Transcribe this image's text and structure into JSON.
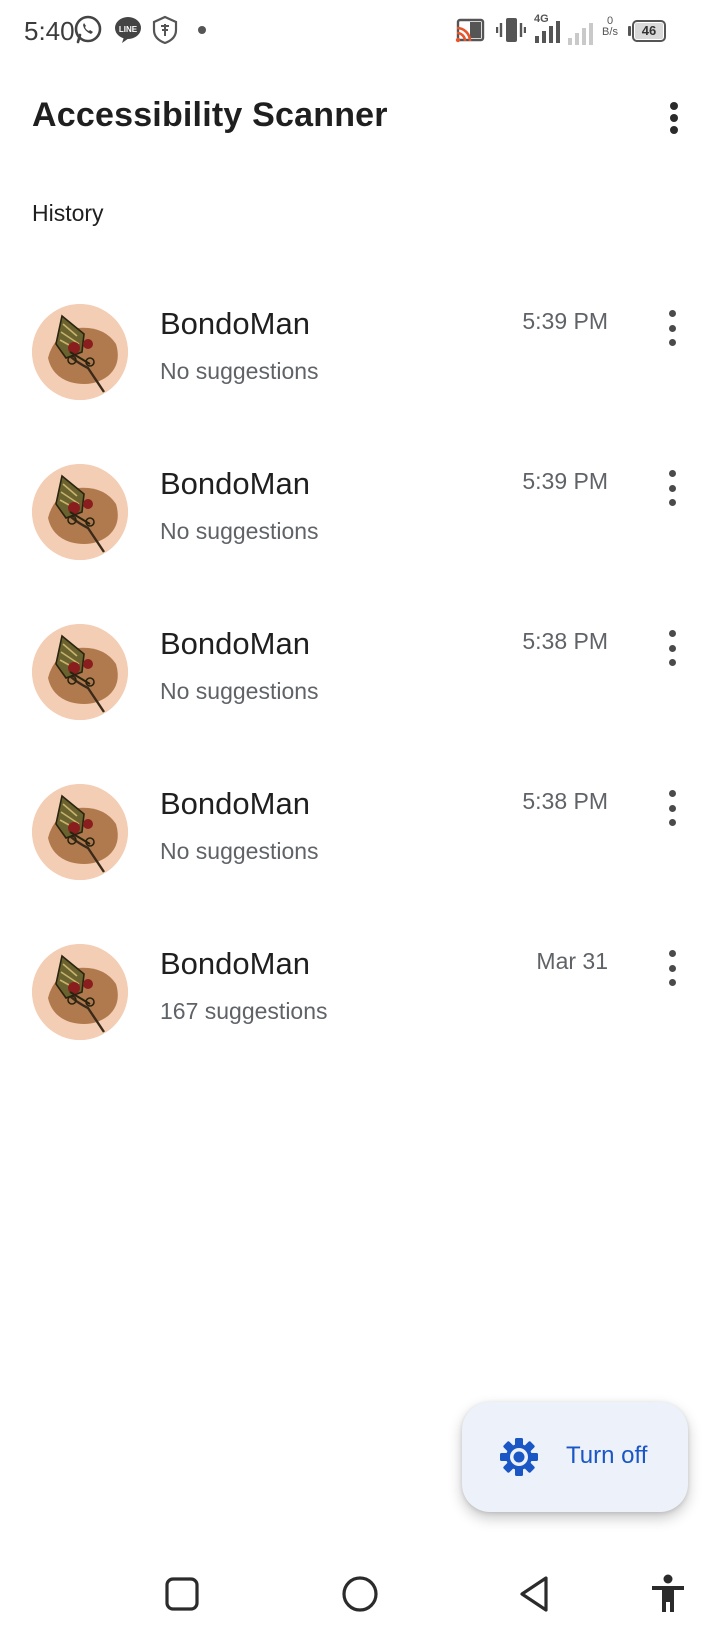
{
  "status_bar": {
    "time": "5:40",
    "network": "4G",
    "speed_value": "0",
    "speed_unit": "B/s",
    "battery": "46",
    "icons": [
      "whatsapp-icon",
      "line-icon",
      "vpn-icon",
      "notification-dot-icon",
      "cast-icon",
      "vibrate-icon",
      "signal-4g-icon",
      "signal-icon",
      "battery-icon"
    ]
  },
  "app_bar": {
    "title": "Accessibility Scanner",
    "menu_icon": "more-vert-icon"
  },
  "section": {
    "title": "History"
  },
  "history": [
    {
      "app": "BondoMan",
      "summary": "No suggestions",
      "time": "5:39 PM"
    },
    {
      "app": "BondoMan",
      "summary": "No suggestions",
      "time": "5:39 PM"
    },
    {
      "app": "BondoMan",
      "summary": "No suggestions",
      "time": "5:38 PM"
    },
    {
      "app": "BondoMan",
      "summary": "No suggestions",
      "time": "5:38 PM"
    },
    {
      "app": "BondoMan",
      "summary": "167 suggestions",
      "time": "Mar 31"
    }
  ],
  "fab": {
    "label": "Turn off",
    "icon": "settings-gear-icon"
  },
  "nav_bar": {
    "icons": [
      "recents-square-icon",
      "home-circle-icon",
      "back-triangle-icon",
      "accessibility-icon"
    ]
  },
  "colors": {
    "accent": "#1a56c4",
    "fab_background": "#edf1f9",
    "avatar_background": "#f3cdb4",
    "secondary_text": "#5f6368",
    "cast_icon": "#e8552b"
  }
}
